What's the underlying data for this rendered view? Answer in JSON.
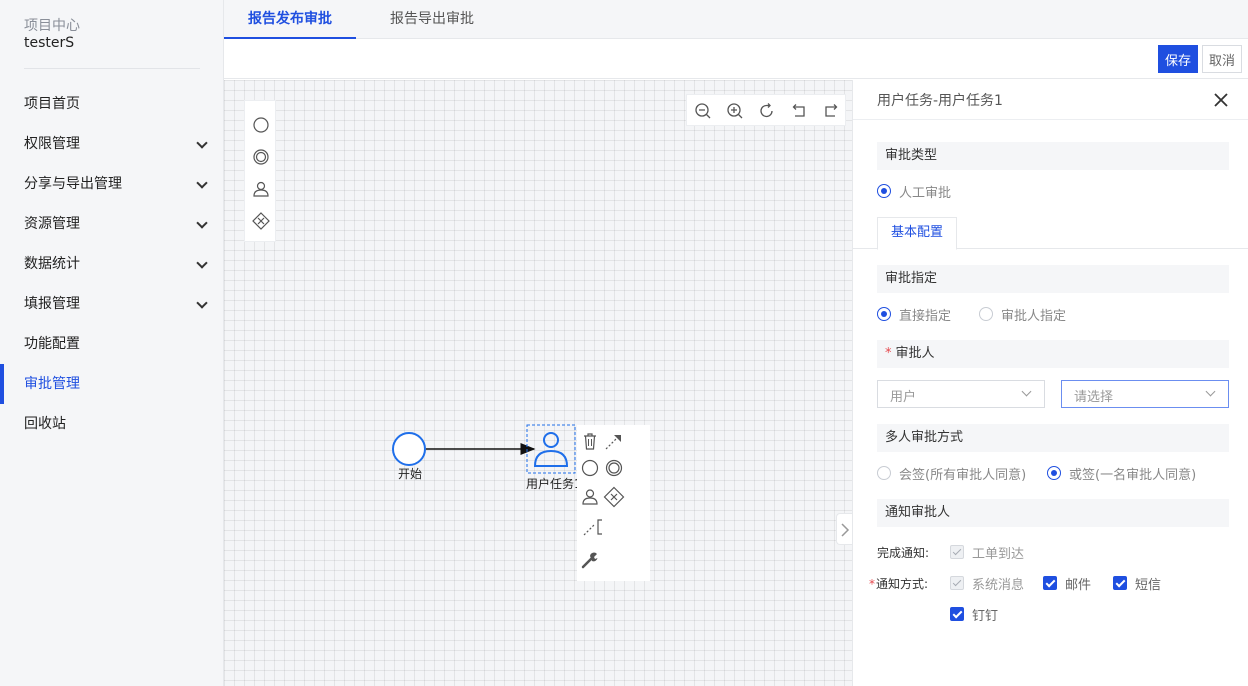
{
  "sidebar": {
    "project_label": "项目中心",
    "project_name": "testerS",
    "items": [
      {
        "label": "项目首页"
      },
      {
        "label": "权限管理"
      },
      {
        "label": "分享与导出管理"
      },
      {
        "label": "资源管理"
      },
      {
        "label": "数据统计"
      },
      {
        "label": "填报管理"
      },
      {
        "label": "功能配置"
      },
      {
        "label": "审批管理"
      },
      {
        "label": "回收站"
      }
    ]
  },
  "tabs": [
    {
      "label": "报告发布审批"
    },
    {
      "label": "报告导出审批"
    }
  ],
  "toolbar": {
    "save_label": "保存",
    "cancel_label": "取消"
  },
  "canvas": {
    "start_label": "开始",
    "task_label": "用户任务1"
  },
  "panel": {
    "title": "用户任务-用户任务1",
    "approval_type_title": "审批类型",
    "approval_type_option": "人工审批",
    "subtab": "基本配置",
    "assign_title": "审批指定",
    "assign_direct": "直接指定",
    "assign_by_approver": "审批人指定",
    "approver_title": "审批人",
    "approver_type_value": "用户",
    "approver_placeholder": "请选择",
    "multi_title": "多人审批方式",
    "multi_all": "会签(所有审批人同意)",
    "multi_any": "或签(一名审批人同意)",
    "notify_title": "通知审批人",
    "complete_notify_label": "完成通知:",
    "complete_option": "工单到达",
    "notify_method_label": "通知方式:",
    "method_system": "系统消息",
    "method_email": "邮件",
    "method_sms": "短信",
    "method_dingtalk": "钉钉"
  },
  "colors": {
    "accent": "#1f4fe0"
  }
}
